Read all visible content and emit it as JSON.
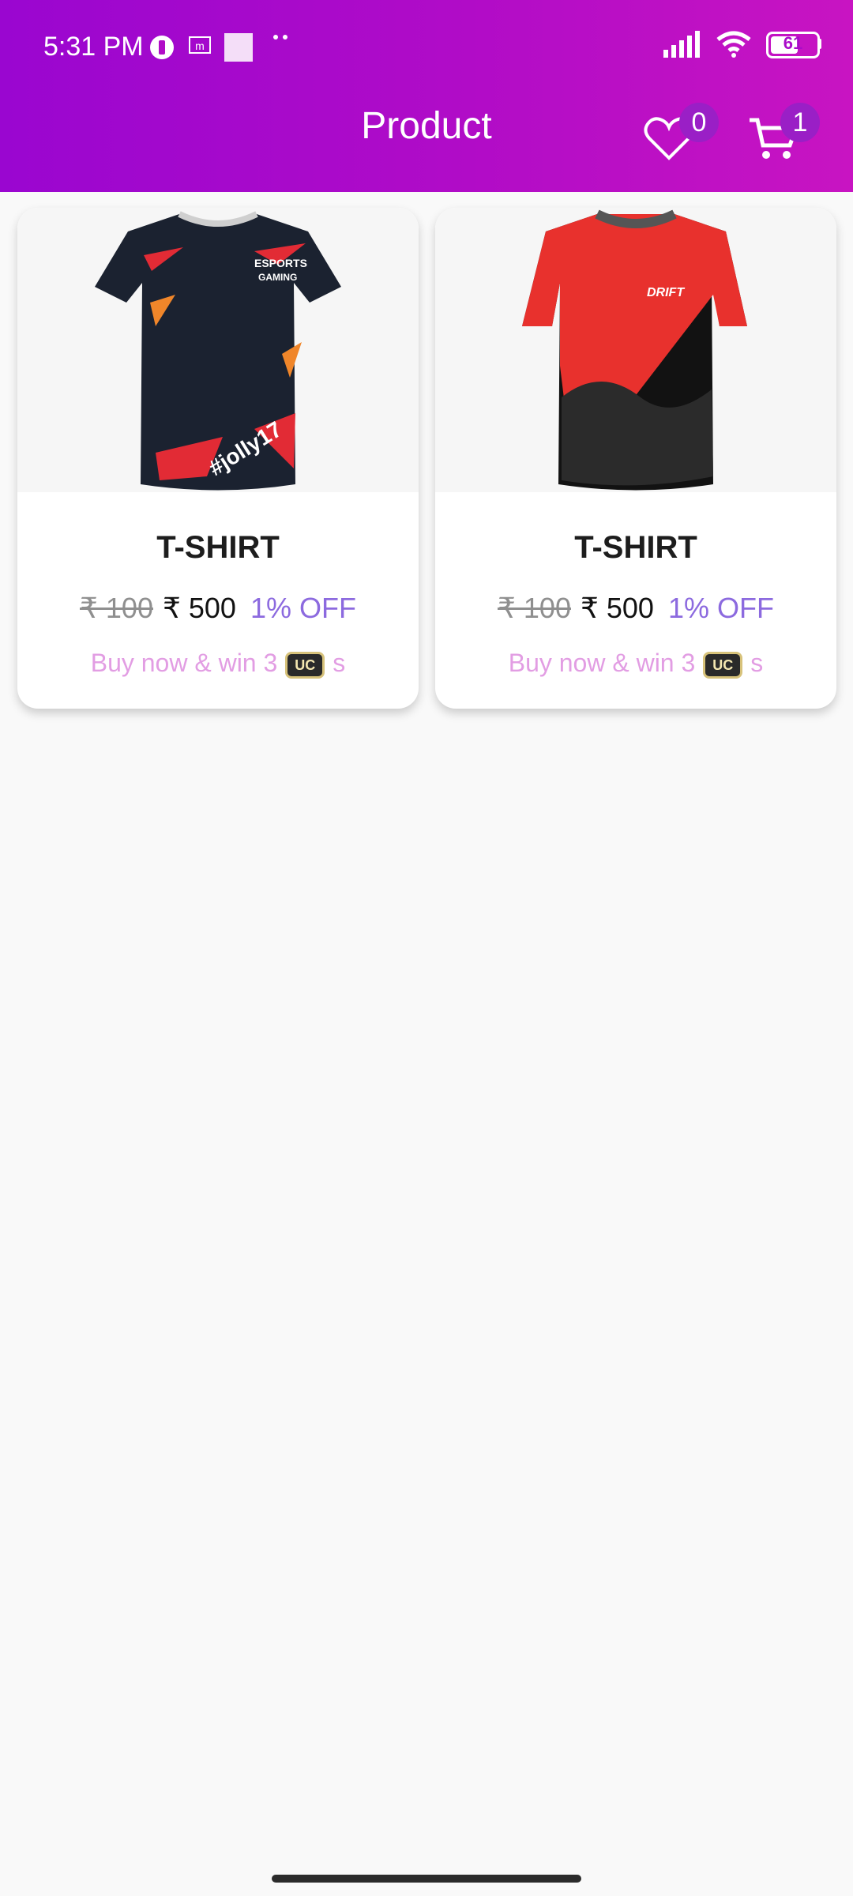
{
  "status_bar": {
    "time": "5:31 PM",
    "battery": "61"
  },
  "app_bar": {
    "title": "Product",
    "wishlist_count": "0",
    "cart_count": "1"
  },
  "products": [
    {
      "title": "T-SHIRT",
      "old_price": "₹ 100",
      "price": "₹ 500",
      "discount": "1% OFF",
      "promo_prefix": "Buy now & win 3",
      "promo_suffix": "s",
      "badge": "UC",
      "jersey_front_text": "ESPORTS\nGAMING",
      "jersey_tag": "#jolly17"
    },
    {
      "title": "T-SHIRT",
      "old_price": "₹ 100",
      "price": "₹ 500",
      "discount": "1% OFF",
      "promo_prefix": "Buy now & win 3",
      "promo_suffix": "s",
      "badge": "UC",
      "jersey_front_text": "DRIFT"
    }
  ],
  "colors": {
    "header_gradient": [
      "#9a06d0",
      "#c814c2"
    ],
    "discount": "#8c6adf",
    "promo": "#e29de3",
    "badge": "#9a1fc6"
  }
}
